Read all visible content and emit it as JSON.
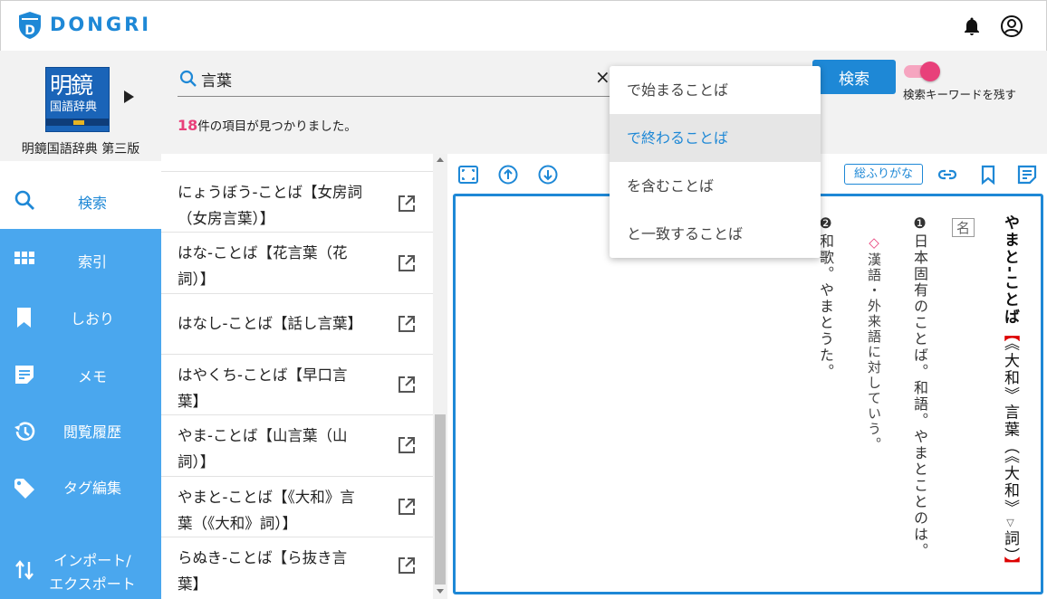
{
  "header": {
    "logo_text": "DONGRI",
    "icons": [
      "bell-icon",
      "account-icon"
    ]
  },
  "dictionary": {
    "cover_title_line1": "明鏡",
    "cover_title_line2": "国語辞典",
    "name": "明鏡国語辞典 第三版"
  },
  "search": {
    "query": "言葉",
    "placeholder": "",
    "clear_label": "×",
    "result_count": "18",
    "result_suffix": "件の項目が見つかりました。",
    "button_label": "検索",
    "keep_keyword_label": "検索キーワードを残す",
    "keep_keyword_on": true
  },
  "search_mode_menu": {
    "options": [
      "で始まることば",
      "で終わることば",
      "を含むことば",
      "と一致することば"
    ],
    "highlighted_index": 1
  },
  "nav": {
    "items": [
      {
        "label": "検索",
        "icon": "search-icon",
        "active": true
      },
      {
        "label": "索引",
        "icon": "grid-icon",
        "active": false
      },
      {
        "label": "しおり",
        "icon": "bookmark-icon",
        "active": false
      },
      {
        "label": "メモ",
        "icon": "memo-icon",
        "active": false
      },
      {
        "label": "閲覧履歴",
        "icon": "history-icon",
        "active": false
      },
      {
        "label": "タグ編集",
        "icon": "tag-icon",
        "active": false
      },
      {
        "label": "インポート/\nエクスポート",
        "label_line1": "インポート/",
        "label_line2": "エクスポート",
        "icon": "import-export-icon",
        "active": false
      }
    ]
  },
  "results": [
    {
      "line1": "にょうぼう-ことば【女房詞",
      "line2": "（女房言葉）】"
    },
    {
      "line1": "はな-ことば【花言葉（花",
      "line2": "詞）】"
    },
    {
      "line1": "はなし-ことば【話し言葉】",
      "line2": ""
    },
    {
      "line1": "はやくち-ことば【早口言",
      "line2": "葉】"
    },
    {
      "line1": "やま-ことば【山言葉（山",
      "line2": "詞）】"
    },
    {
      "line1": "やまと-ことば【《大和》言",
      "line2": "葉（《大和》詞）】"
    },
    {
      "line1": "らぬき-ことば【ら抜き言",
      "line2": "葉】"
    }
  ],
  "toolbar": {
    "icons": [
      "fit-screen-icon",
      "arrow-up-circle-icon",
      "arrow-down-circle-icon",
      "link-icon",
      "bookmark-icon",
      "memo-icon"
    ],
    "furigana_label": "総ふりがな"
  },
  "entry": {
    "headword": "やまと‐ことば",
    "bracket_open": "【",
    "notation": "《大和》言葉（《大和》",
    "notation_mark": "▽",
    "notation_end": "詞）",
    "bracket_close": "】",
    "pos": "名",
    "sense1_marker": "❶",
    "sense1_text": "日本固有のことば。和語。やまとことのは。",
    "note_marker": "◇",
    "note_text": "漢語・外来語に対していう。",
    "sense2_marker": "❷",
    "sense2_text": "和歌。やまとうた。"
  },
  "colors": {
    "accent": "#1e88d6",
    "nav_bg": "#4aa7ee",
    "pink": "#e8407a",
    "bracket_red": "#dd0000"
  }
}
